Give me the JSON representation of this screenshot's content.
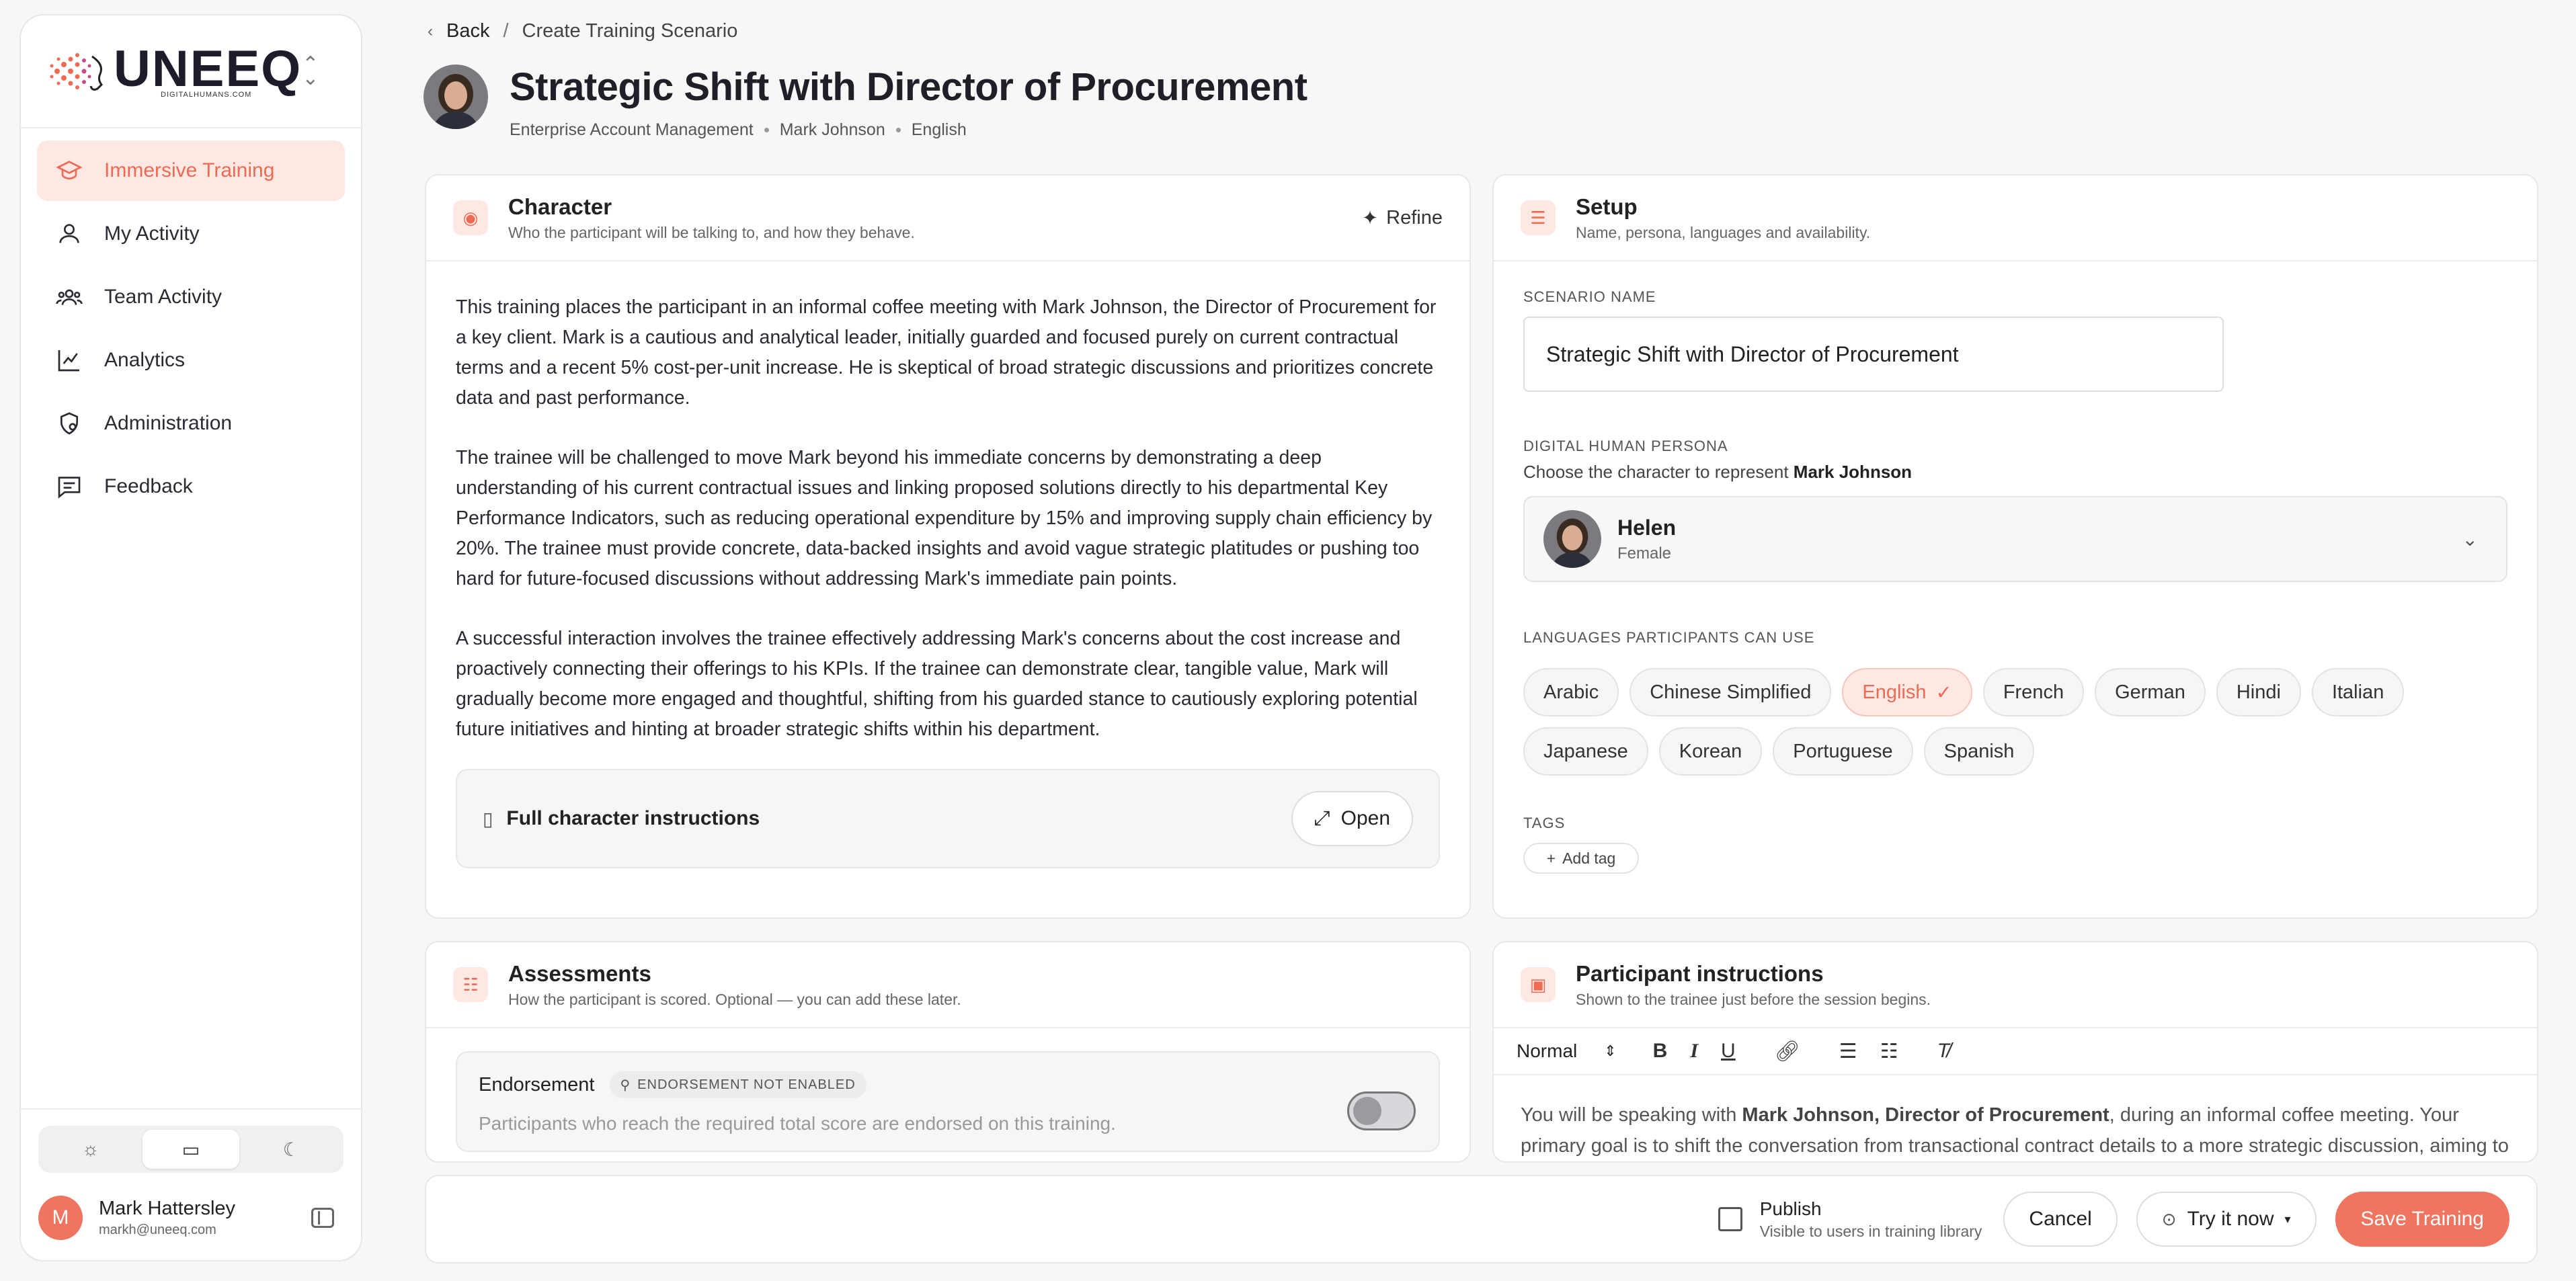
{
  "brand": {
    "name": "UNEEQ",
    "sub": "DIGITALHUMANS.COM"
  },
  "sidebar": {
    "items": [
      {
        "label": "Immersive Training"
      },
      {
        "label": "My Activity"
      },
      {
        "label": "Team Activity"
      },
      {
        "label": "Analytics"
      },
      {
        "label": "Administration"
      },
      {
        "label": "Feedback"
      }
    ],
    "user": {
      "initial": "M",
      "name": "Mark Hattersley",
      "email": "markh@uneeq.com"
    }
  },
  "breadcrumb": {
    "back": "Back",
    "sep": "/",
    "current": "Create Training Scenario"
  },
  "page": {
    "title": "Strategic Shift with Director of Procurement",
    "meta": [
      "Enterprise Account Management",
      "Mark Johnson",
      "English"
    ]
  },
  "character": {
    "title": "Character",
    "subtitle": "Who the participant will be talking to, and how they behave.",
    "refine": "Refine",
    "paragraphs": [
      "This training places the participant in an informal coffee meeting with Mark Johnson, the Director of Procurement for a key client. Mark is a cautious and analytical leader, initially guarded and focused purely on current contractual terms and a recent 5% cost-per-unit increase. He is skeptical of broad strategic discussions and prioritizes concrete data and past performance.",
      "The trainee will be challenged to move Mark beyond his immediate concerns by demonstrating a deep understanding of his current contractual issues and linking proposed solutions directly to his departmental Key Performance Indicators, such as reducing operational expenditure by 15% and improving supply chain efficiency by 20%. The trainee must provide concrete, data-backed insights and avoid vague strategic platitudes or pushing too hard for future-focused discussions without addressing Mark's immediate pain points.",
      "A successful interaction involves the trainee effectively addressing Mark's concerns about the cost increase and proactively connecting their offerings to his KPIs. If the trainee can demonstrate clear, tangible value, Mark will gradually become more engaged and thoughtful, shifting from his guarded stance to cautiously exploring potential future initiatives and hinting at broader strategic shifts within his department."
    ],
    "instructions_label": "Full character instructions",
    "open": "Open"
  },
  "setup": {
    "title": "Setup",
    "subtitle": "Name, persona, languages and availability.",
    "name_label": "SCENARIO NAME",
    "name_value": "Strategic Shift with Director of Procurement",
    "persona_label": "DIGITAL HUMAN PERSONA",
    "persona_hint": "Choose the character to represent",
    "persona_hint_name": "Mark Johnson",
    "persona_name": "Helen",
    "persona_gender": "Female",
    "languages_label": "LANGUAGES PARTICIPANTS CAN USE",
    "languages": [
      "Arabic",
      "Chinese Simplified",
      "English",
      "French",
      "German",
      "Hindi",
      "Italian",
      "Japanese",
      "Korean",
      "Portuguese",
      "Spanish"
    ],
    "selected_language": "English",
    "tags_label": "TAGS",
    "add_tag": "Add tag"
  },
  "assessments": {
    "title": "Assessments",
    "subtitle": "How the participant is scored. Optional — you can add these later.",
    "endorsement": "Endorsement",
    "badge": "ENDORSEMENT NOT ENABLED",
    "desc": "Participants who reach the required total score are endorsed on this training."
  },
  "participant": {
    "title": "Participant instructions",
    "subtitle": "Shown to the trainee just before the session begins.",
    "format": "Normal",
    "text_pre": "You will be speaking with ",
    "text_bold": "Mark Johnson, Director of Procurement",
    "text_post": ", during an informal coffee meeting. Your primary goal is to shift the conversation from transactional contract details to a more strategic discussion, aiming to"
  },
  "footer": {
    "publish": "Publish",
    "publish_sub": "Visible to users in training library",
    "cancel": "Cancel",
    "try": "Try it now",
    "save": "Save Training"
  },
  "colors": {
    "accent": "#f07560",
    "accent_soft": "#fde8e3"
  }
}
